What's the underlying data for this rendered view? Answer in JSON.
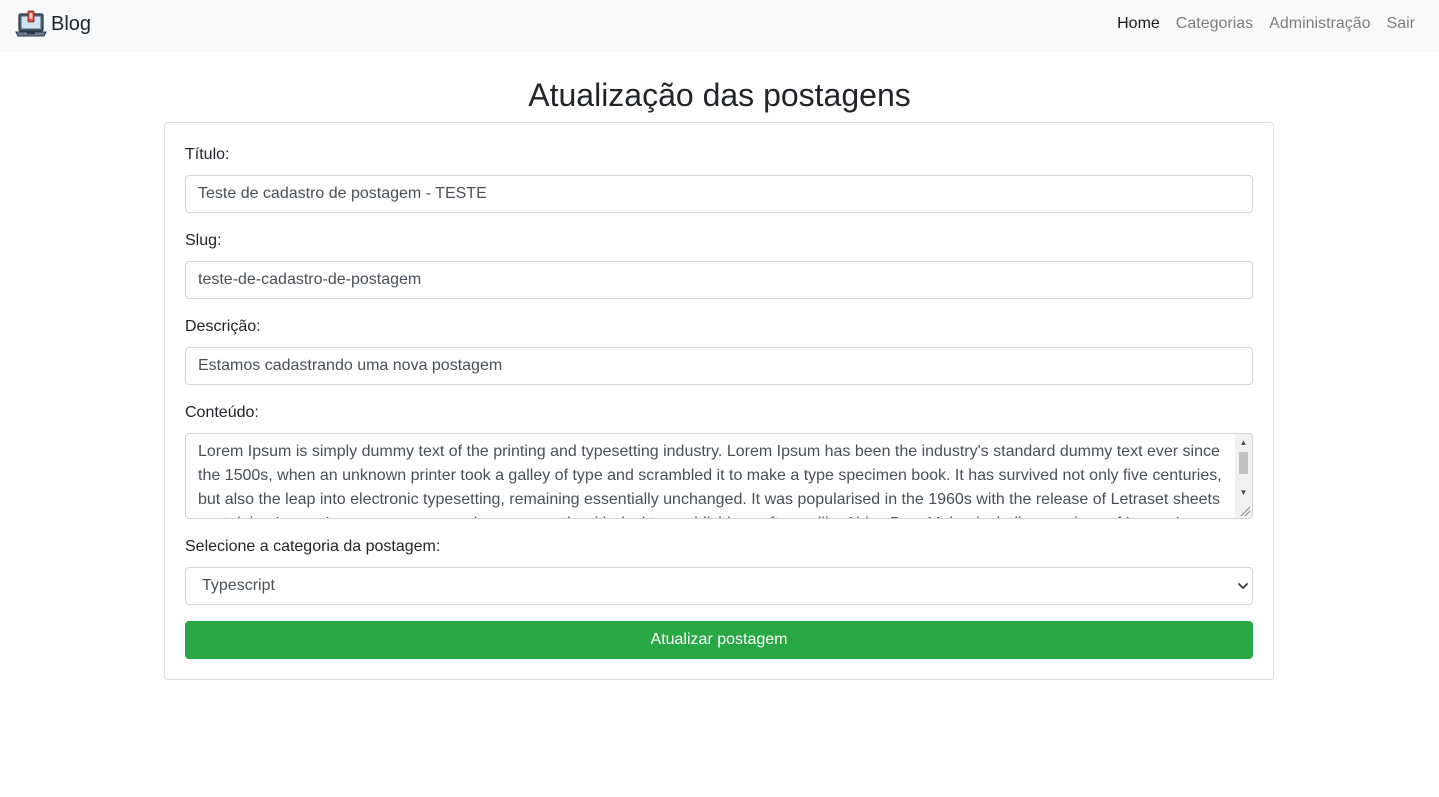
{
  "navbar": {
    "brand": "Blog",
    "brand_icon": "laptop-icon",
    "links": [
      {
        "label": "Home",
        "active": true
      },
      {
        "label": "Categorias",
        "active": false
      },
      {
        "label": "Administração",
        "active": false
      },
      {
        "label": "Sair",
        "active": false
      }
    ]
  },
  "page": {
    "title": "Atualização das postagens"
  },
  "form": {
    "titulo_label": "Título:",
    "titulo_value": "Teste de cadastro de postagem - TESTE",
    "slug_label": "Slug:",
    "slug_value": "teste-de-cadastro-de-postagem",
    "descricao_label": "Descrição:",
    "descricao_value": "Estamos cadastrando uma nova postagem",
    "conteudo_label": "Conteúdo:",
    "conteudo_value": "Lorem Ipsum is simply dummy text of the printing and typesetting industry. Lorem Ipsum has been the industry's standard dummy text ever since the 1500s, when an unknown printer took a galley of type and scrambled it to make a type specimen book. It has survived not only five centuries, but also the leap into electronic typesetting, remaining essentially unchanged. It was popularised in the 1960s with the release of Letraset sheets containing Lorem Ipsum passages, and more recently with desktop publishing software like Aldus PageMaker including versions of Lorem Ipsum.",
    "categoria_label": "Selecione a categoria da postagem:",
    "categoria_value": "Typescript",
    "submit_label": "Atualizar postagem"
  },
  "colors": {
    "navbar_bg": "#f8f9fa",
    "button_bg": "#28a745",
    "border": "#ced4da"
  }
}
